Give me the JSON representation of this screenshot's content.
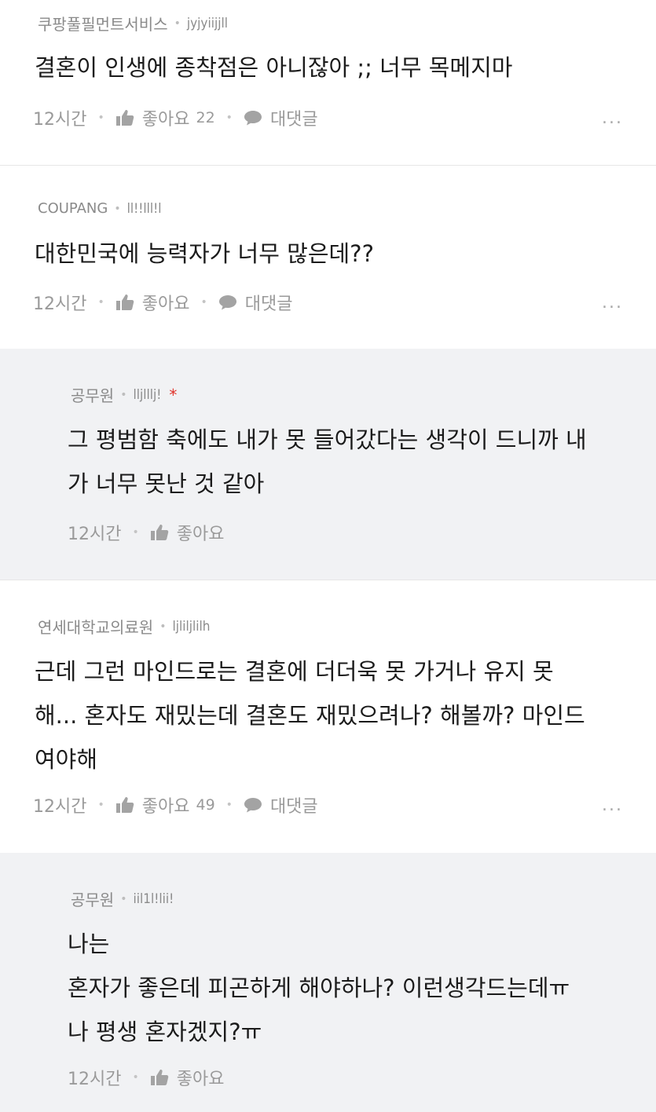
{
  "comments": [
    {
      "company": "쿠팡풀필먼트서비스",
      "nickname": "jyjyiijjll",
      "text": "결혼이 인생에 종착점은 아니잖아 ;; 너무 목메지마",
      "time": "12시간",
      "like_label": "좋아요",
      "like_count": "22",
      "reply_label": "대댓글",
      "more": "..."
    },
    {
      "company": "COUPANG",
      "nickname": "ll!!lll!l",
      "text": "대한민국에 능력자가 너무 많은데??",
      "time": "12시간",
      "like_label": "좋아요",
      "reply_label": "대댓글",
      "more": "..."
    },
    {
      "company": "공무원",
      "nickname": "lljlllj!",
      "author_mark": "*",
      "text": "그 평범함 축에도 내가 못 들어갔다는 생각이 드니까 내\n가 너무 못난 것 같아",
      "time": "12시간",
      "like_label": "좋아요"
    },
    {
      "company": "연세대학교의료원",
      "nickname": "ljliljlilh",
      "text": "근데 그런 마인드로는 결혼에 더더욱 못 가거나 유지 못\n해... 혼자도 재밌는데 결혼도 재밌으려나? 해볼까? 마인드\n여야해",
      "time": "12시간",
      "like_label": "좋아요",
      "like_count": "49",
      "reply_label": "대댓글",
      "more": "..."
    },
    {
      "company": "공무원",
      "nickname": "iil1l!lii!",
      "text": "나는\n혼자가 좋은데 피곤하게 해야하나? 이런생각드는데ㅠ\n나 평생 혼자겠지?ㅠ",
      "time": "12시간",
      "like_label": "좋아요"
    }
  ],
  "icons": {
    "separator": "•",
    "like": "thumbs-up-icon",
    "reply": "speech-bubble-icon",
    "more": "more-options-icon"
  },
  "colors": {
    "reply_background": "#f1f2f4",
    "author_mark": "#e0332a",
    "meta_text": "#8a8a8a"
  }
}
